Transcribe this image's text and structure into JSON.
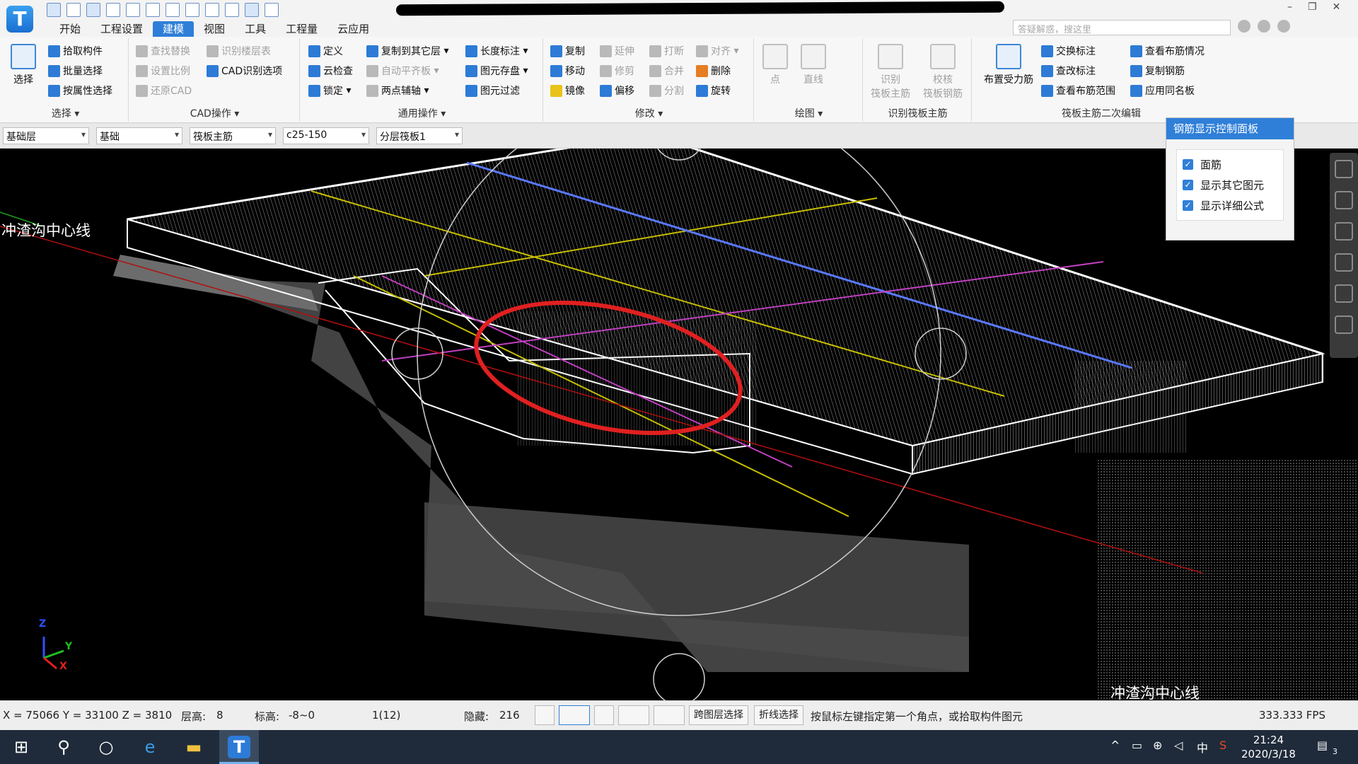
{
  "app": {
    "logo_letter": "T",
    "search_placeholder": "答疑解惑，搜这里"
  },
  "menu": {
    "tabs": [
      "开始",
      "工程设置",
      "建模",
      "视图",
      "工具",
      "工程量",
      "云应用"
    ],
    "active": "建模"
  },
  "ribbon": {
    "select_group": {
      "big_label": "选择",
      "items": [
        "拾取构件",
        "批量选择",
        "按属性选择"
      ],
      "group_label": "选择"
    },
    "cad_group": {
      "items": [
        "查找替换",
        "识别楼层表",
        "设置比例",
        "CAD识别选项",
        "还原CAD"
      ],
      "group_label": "CAD操作"
    },
    "general_group": {
      "items": [
        "定义",
        "复制到其它层",
        "长度标注",
        "云检查",
        "自动平齐板",
        "图元存盘",
        "锁定",
        "两点辅轴",
        "图元过滤"
      ],
      "group_label": "通用操作"
    },
    "modify_group": {
      "items": [
        "复制",
        "延伸",
        "打断",
        "对齐",
        "移动",
        "修剪",
        "合并",
        "删除",
        "镜像",
        "偏移",
        "分割",
        "旋转"
      ],
      "group_label": "修改"
    },
    "draw_group": {
      "items": [
        "点",
        "直线"
      ],
      "group_label": "绘图"
    },
    "raft_identify_group": {
      "items": [
        "识别\n筏板主筋",
        "校核\n筏板钢筋"
      ],
      "group_label": "识别筏板主筋"
    },
    "raft_edit_group": {
      "big_label": "布置受力筋",
      "items": [
        "交换标注",
        "查看布筋情况",
        "查改标注",
        "复制钢筋",
        "查看布筋范围",
        "应用同名板"
      ],
      "group_label": "筏板主筋二次编辑"
    }
  },
  "filters": [
    "基础层",
    "基础",
    "筏板主筋",
    "c25-150",
    "分层筏板1"
  ],
  "panel": {
    "title": "钢筋显示控制面板",
    "options": [
      {
        "label": "面筋",
        "checked": true
      },
      {
        "label": "显示其它图元",
        "checked": true
      },
      {
        "label": "显示详细公式",
        "checked": true
      }
    ]
  },
  "viewport": {
    "axis_label_left": "冲渣沟中心线",
    "axis_label_right": "冲渣沟中心线",
    "axes": [
      "Z",
      "Y",
      "X"
    ]
  },
  "status": {
    "coords": "X = 75066 Y = 33100 Z = 3810",
    "floor_height_label": "层高:",
    "floor_height": "8",
    "elevation_label": "标高:",
    "elevation": "-8~0",
    "count": "1(12)",
    "hidden_label": "隐藏:",
    "hidden": "216",
    "cross_layer_btn": "跨图层选择",
    "polyline_btn": "折线选择",
    "hint": "按鼠标左键指定第一个角点，或拾取构件图元",
    "fps": "333.333 FPS"
  },
  "taskbar": {
    "time": "21:24",
    "date": "2020/3/18",
    "notifications": "3",
    "ime": "中"
  },
  "colors": {
    "accent": "#2f7fd8",
    "annotation": "#e02020",
    "rebar_yellow": "#c8c000",
    "rebar_blue": "#5a78ff",
    "rebar_magenta": "#c040c0"
  }
}
